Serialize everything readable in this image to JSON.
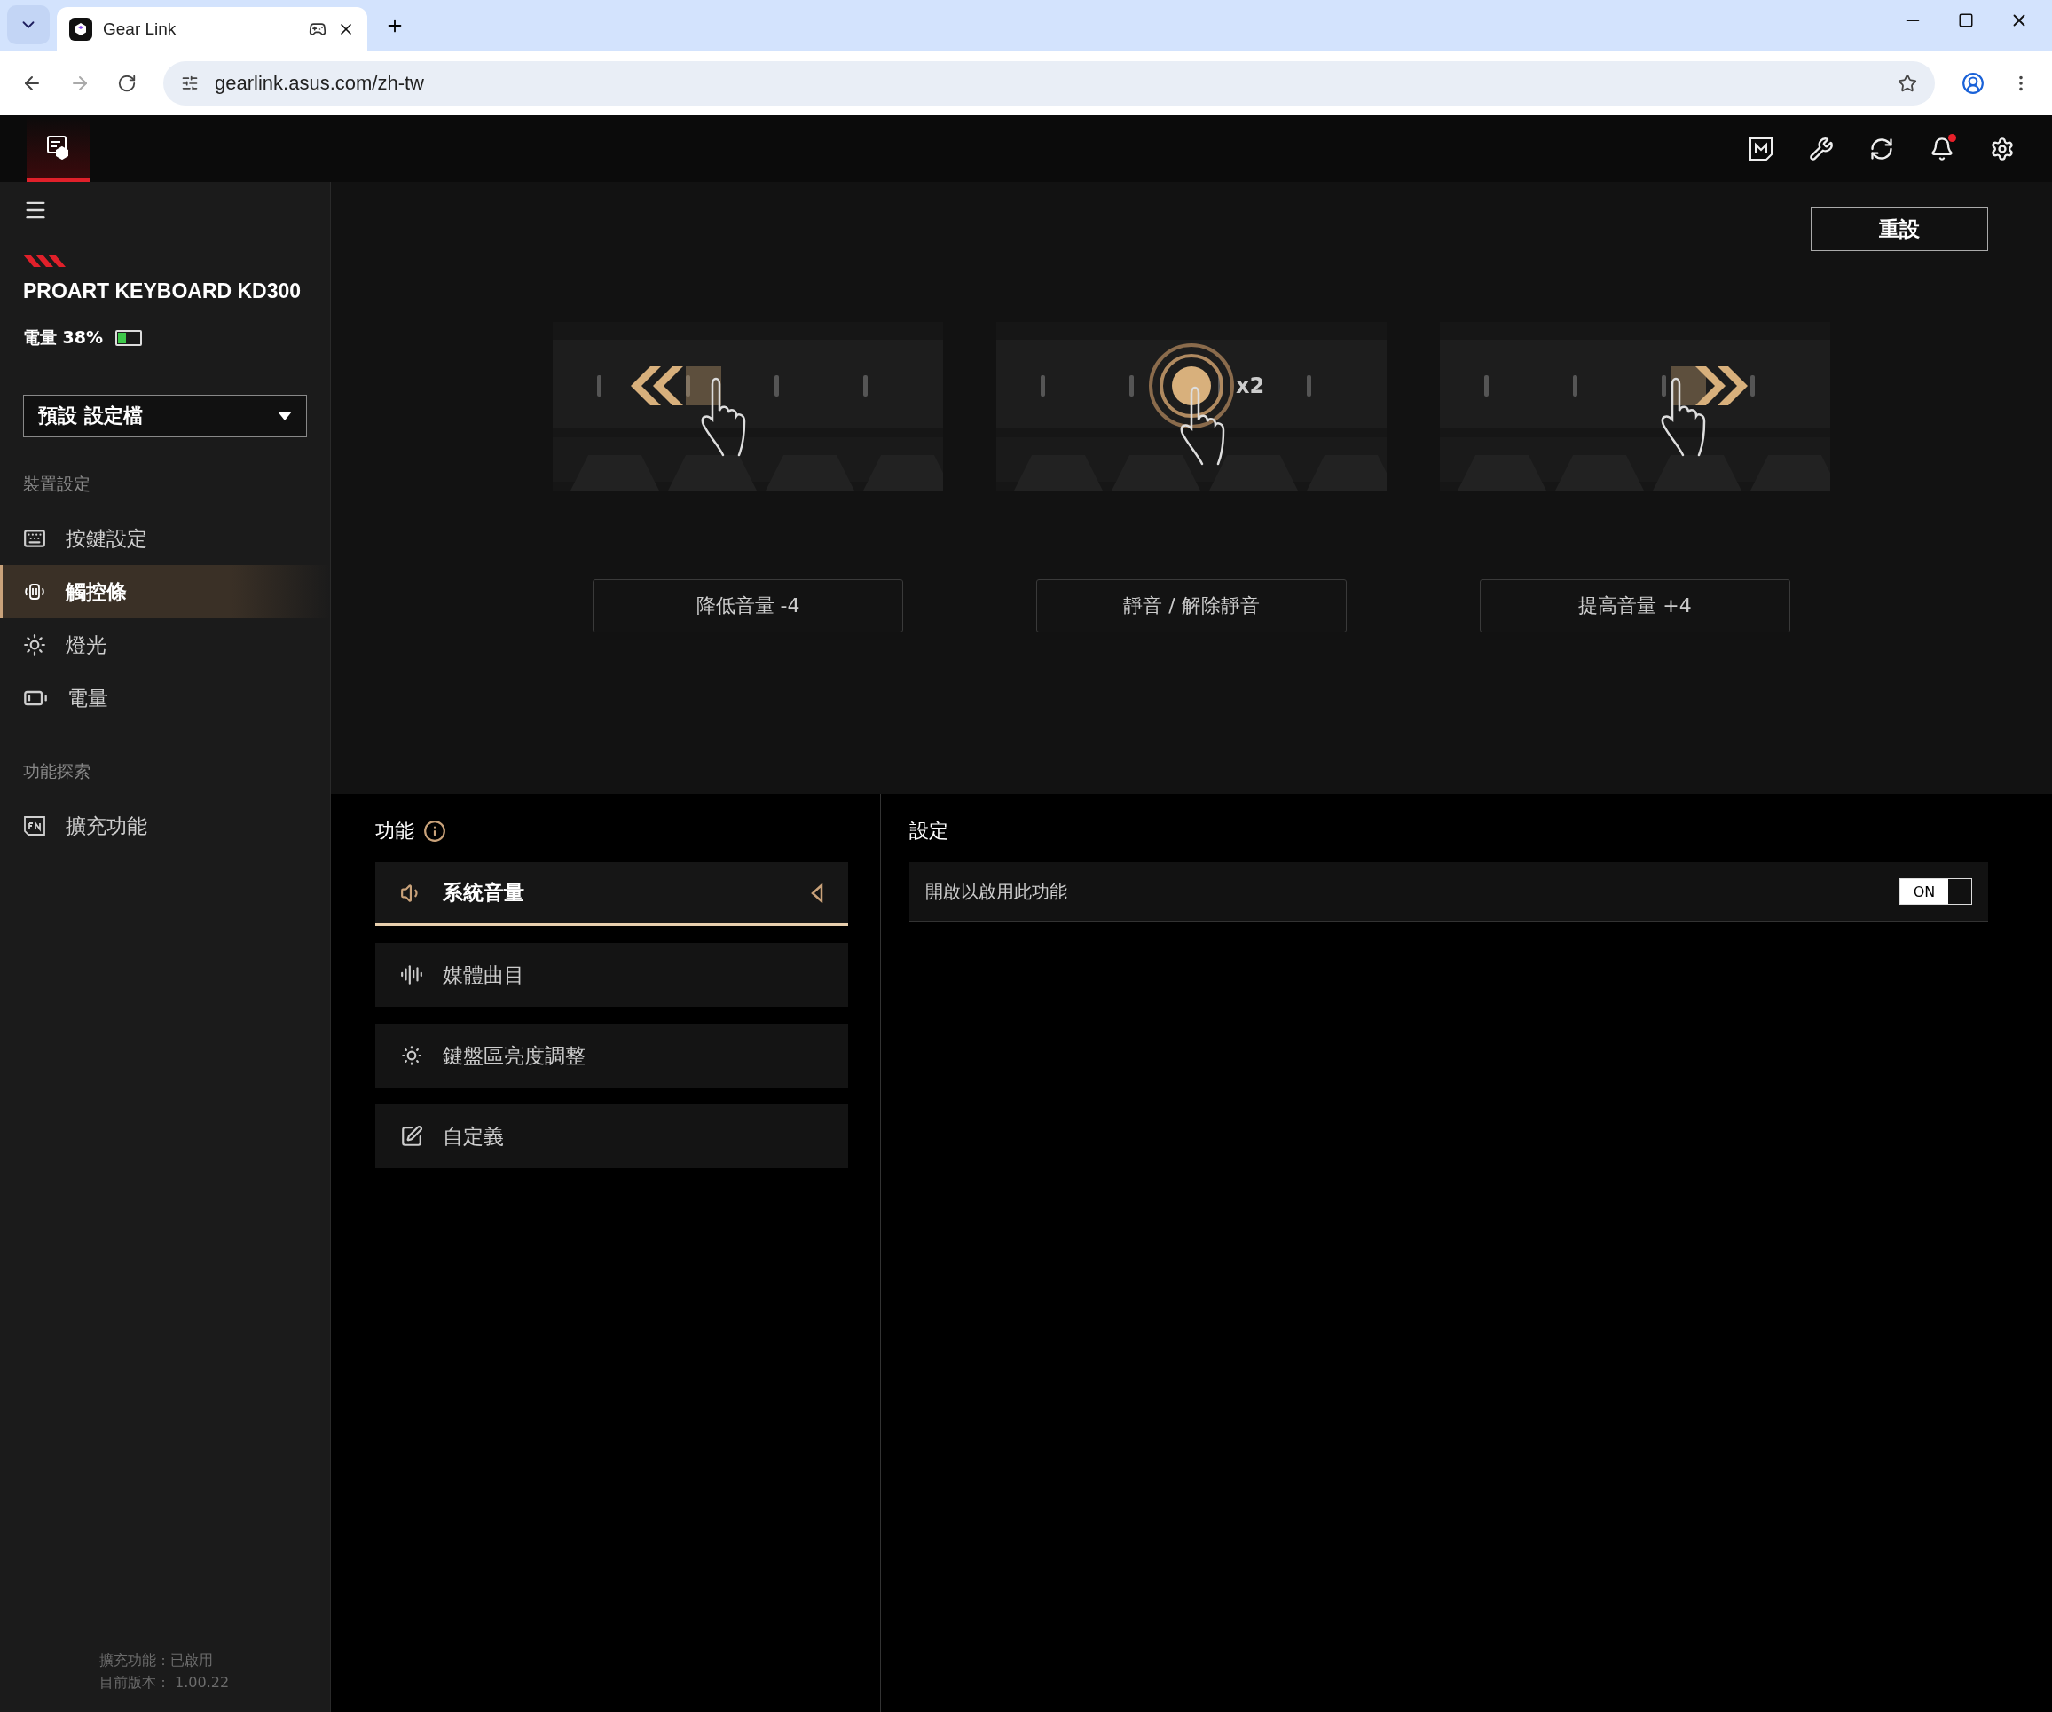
{
  "browser": {
    "tabs": [
      {
        "title": "Gear Link",
        "selected": true
      }
    ],
    "url": "gearlink.asus.com/zh-tw"
  },
  "sidebar": {
    "device_name": "PROART KEYBOARD KD300",
    "battery": {
      "label": "電量 38%",
      "level": 0.38
    },
    "profile_select": {
      "value": "預設 設定檔"
    },
    "sections": [
      {
        "title": "裝置設定",
        "items": [
          {
            "label": "按鍵設定",
            "kind": "keyboard",
            "selected": false
          },
          {
            "label": "觸控條",
            "kind": "touchbar",
            "selected": true
          },
          {
            "label": "燈光",
            "kind": "light",
            "selected": false
          },
          {
            "label": "電量",
            "kind": "battery",
            "selected": false
          }
        ]
      },
      {
        "title": "功能探索",
        "items": [
          {
            "label": "擴充功能",
            "kind": "fn",
            "selected": false
          }
        ]
      }
    ],
    "footer": [
      "擴充功能：已啟用",
      "目前版本： 1.00.22"
    ]
  },
  "main": {
    "reset_button": "重設",
    "gestures": [
      {
        "kind": "swipe_left",
        "label": "降低音量 -4"
      },
      {
        "kind": "double_tap",
        "label": "靜音 / 解除靜音",
        "badge": "x2"
      },
      {
        "kind": "swipe_right",
        "label": "提高音量 +4"
      }
    ],
    "functions": {
      "title": "功能",
      "items": [
        {
          "label": "系統音量",
          "kind": "volume",
          "selected": true
        },
        {
          "label": "媒體曲目",
          "kind": "media",
          "selected": false
        },
        {
          "label": "鍵盤區亮度調整",
          "kind": "brightness",
          "selected": false
        },
        {
          "label": "自定義",
          "kind": "custom",
          "selected": false
        }
      ]
    },
    "settings": {
      "title": "設定",
      "rows": [
        {
          "label": "開啟以啟用此功能",
          "toggle_text": "ON",
          "on": true
        }
      ]
    }
  }
}
